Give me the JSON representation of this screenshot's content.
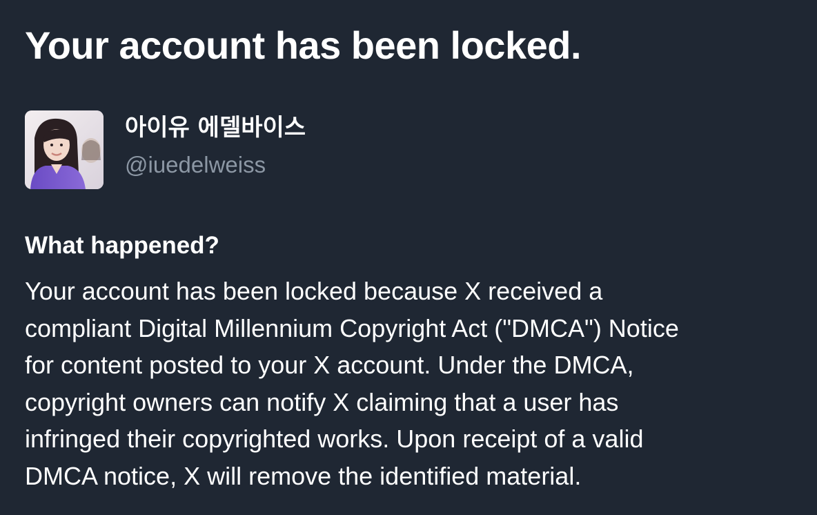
{
  "page": {
    "title": "Your account has been locked."
  },
  "profile": {
    "display_name": "아이유 에델바이스",
    "handle": "@iuedelweiss",
    "avatar_icon": "avatar-photo"
  },
  "section": {
    "heading": "What happened?",
    "body_lines": [
      "Your account has been locked because X received a",
      "compliant Digital Millennium Copyright Act (\"DMCA\") Notice",
      "for content posted to your X account. Under the DMCA,",
      "copyright owners can notify X claiming that a user has",
      "infringed their copyrighted works. Upon receipt of a valid",
      "DMCA notice, X will remove the identified material."
    ]
  },
  "colors": {
    "background": "#1f2733",
    "text": "#ffffff",
    "muted_text": "#8c97a4"
  }
}
